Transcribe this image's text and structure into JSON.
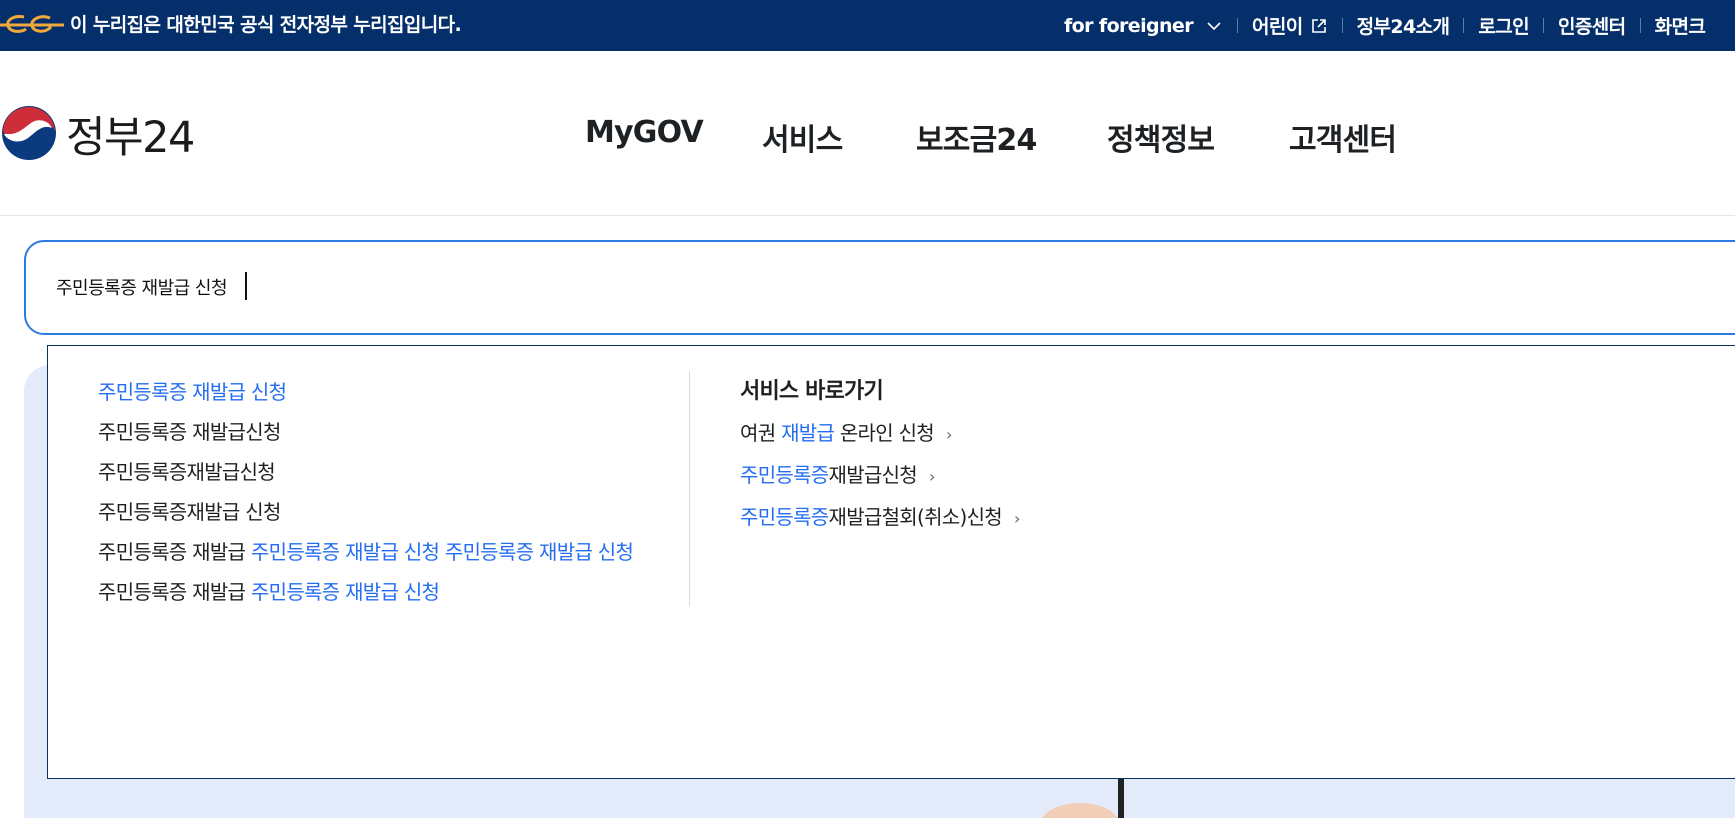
{
  "gov_banner": {
    "notice": "이 누리집은 대한민국 공식 전자정부 누리집입니다.",
    "links": [
      {
        "label": "for foreigner"
      },
      {
        "label": "어린이"
      },
      {
        "label": "정부24소개"
      },
      {
        "label": "로그인"
      },
      {
        "label": "인증센터"
      },
      {
        "label": "화면크"
      }
    ]
  },
  "header": {
    "logo_text": "정부24",
    "nav": [
      "MyGOV",
      "서비스",
      "보조금24",
      "정책정보",
      "고객센터"
    ]
  },
  "search": {
    "value": "주민등록증 재발급 신청"
  },
  "suggestions": [
    {
      "plain": "",
      "highlight": "주민등록증 재발급 신청"
    },
    {
      "plain": "주민등록증 재발급신청",
      "highlight": ""
    },
    {
      "plain": "주민등록증재발급신청",
      "highlight": ""
    },
    {
      "plain": "주민등록증재발급 신청",
      "highlight": ""
    },
    {
      "plain": "주민등록증 재발급 ",
      "highlight": "주민등록증 재발급 신청 주민등록증 재발급 신청"
    },
    {
      "plain": "주민등록증 재발급 ",
      "highlight": "주민등록증 재발급 신청"
    }
  ],
  "shortcuts": {
    "title": "서비스 바로가기",
    "items": [
      {
        "pre": "여권 ",
        "highlight": "재발급",
        "post": " 온라인 신청"
      },
      {
        "pre": "",
        "highlight": "주민등록증",
        "post": "재발급신청"
      },
      {
        "pre": "",
        "highlight": "주민등록증",
        "post": "재발급철회(취소)신청"
      }
    ],
    "arrow": "›"
  },
  "colors": {
    "banner_bg": "#052f6b",
    "highlight": "#256ef4",
    "search_border": "#2b7be0",
    "panel_bg": "#e4ecfb"
  }
}
